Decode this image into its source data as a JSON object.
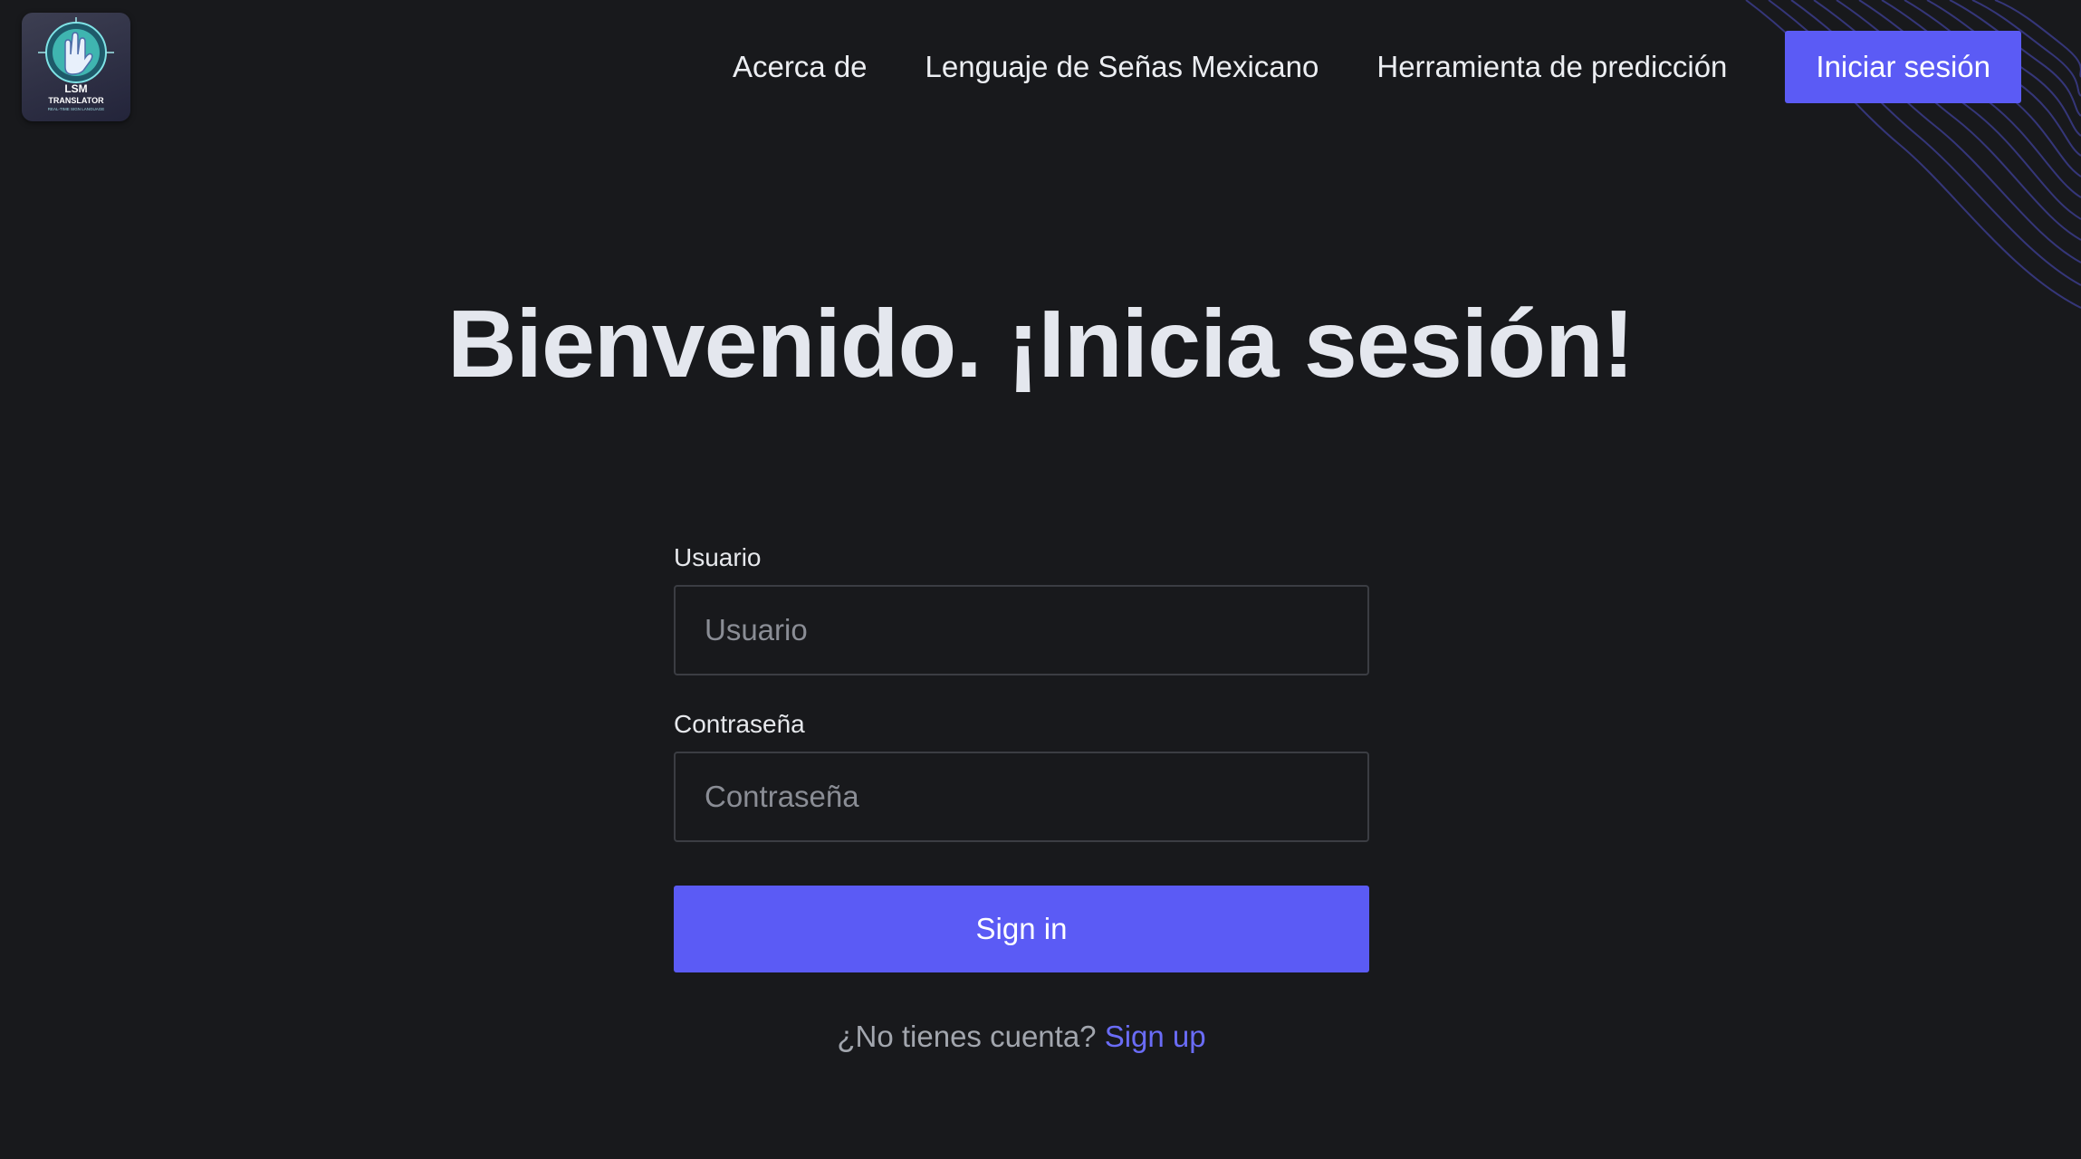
{
  "colors": {
    "background": "#18191c",
    "accent": "#5b5bf5",
    "link": "#6a6cf7",
    "text": "#e6e8ec",
    "muted": "#a2a6ae"
  },
  "logo": {
    "icon": "sign-language-hand-icon",
    "title": "LSM",
    "subtitle": "TRANSLATOR",
    "tagline": "REAL-TIME SIGN LANGUAGE"
  },
  "nav": {
    "items": [
      {
        "label": "Acerca de"
      },
      {
        "label": "Lenguaje de Señas Mexicano"
      },
      {
        "label": "Herramienta de predicción"
      }
    ],
    "cta_label": "Iniciar sesión"
  },
  "main": {
    "headline": "Bienvenido. ¡Inicia sesión!"
  },
  "form": {
    "username": {
      "label": "Usuario",
      "placeholder": "Usuario",
      "value": ""
    },
    "password": {
      "label": "Contraseña",
      "placeholder": "Contraseña",
      "value": ""
    },
    "submit_label": "Sign in",
    "signup_prompt": "¿No tienes cuenta?",
    "signup_link": "Sign up"
  }
}
